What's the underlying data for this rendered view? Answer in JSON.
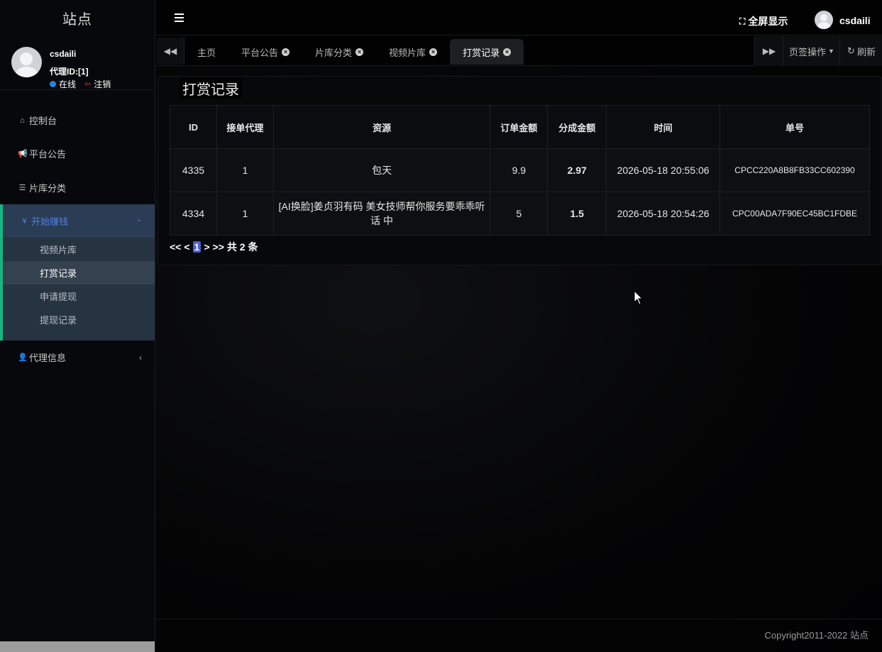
{
  "sidebar": {
    "site_title": "站点",
    "user": {
      "name": "csdaili",
      "agent_id": "代理ID:[1]",
      "status": "在线",
      "logout": "注销"
    },
    "nav": {
      "dashboard": {
        "label": "控制台",
        "icon": "home-icon"
      },
      "announcement": {
        "label": "平台公告",
        "icon": "megaphone-icon"
      },
      "library_category": {
        "label": "片库分类",
        "icon": "list-icon"
      },
      "earn": {
        "label": "开始赚钱",
        "icon": "yen-icon",
        "expanded": true,
        "items": [
          {
            "label": "视频片库",
            "active": false
          },
          {
            "label": "打赏记录",
            "active": true
          },
          {
            "label": "申请提现",
            "active": false
          },
          {
            "label": "提现记录",
            "active": false
          }
        ]
      },
      "agent_info": {
        "label": "代理信息",
        "icon": "user-icon"
      }
    }
  },
  "topbar": {
    "fullscreen_label": "全屏显示",
    "user_name": "csdaili"
  },
  "tabs": {
    "items": [
      {
        "label": "主页",
        "closable": false,
        "active": false
      },
      {
        "label": "平台公告",
        "closable": true,
        "active": false
      },
      {
        "label": "片库分类",
        "closable": true,
        "active": false
      },
      {
        "label": "视频片库",
        "closable": true,
        "active": false
      },
      {
        "label": "打赏记录",
        "closable": true,
        "active": true
      }
    ],
    "ops_label": "页签操作",
    "refresh_label": "刷新"
  },
  "main": {
    "panel_title": "打赏记录",
    "table": {
      "headers": [
        "ID",
        "接单代理",
        "资源",
        "订单金额",
        "分成金额",
        "时间",
        "单号"
      ],
      "rows": [
        {
          "id": "4335",
          "agent": "1",
          "resource": "包天",
          "order_amount": "9.9",
          "share_amount": "2.97",
          "time": "2026-05-18 20:55:06",
          "order_no": "CPCC220A8B8FB33CC602390"
        },
        {
          "id": "4334",
          "agent": "1",
          "resource": "[AI换脸]姜贞羽有码 美女技师帮你服务要乖乖听话 中",
          "order_amount": "5",
          "share_amount": "1.5",
          "time": "2026-05-18 20:54:26",
          "order_no": "CPC00ADA7F90EC45BC1FDBE"
        }
      ]
    },
    "pager": {
      "first": "<<",
      "prev": "<",
      "current": "1",
      "next": ">",
      "last": ">>",
      "total": "共 2 条"
    }
  },
  "footer": {
    "copyright": "Copyright2011-2022 站点"
  },
  "colors": {
    "accent": "#4f7fe0",
    "group_border": "#17b57f",
    "online": "#1e88e5",
    "logout": "#e53935"
  }
}
